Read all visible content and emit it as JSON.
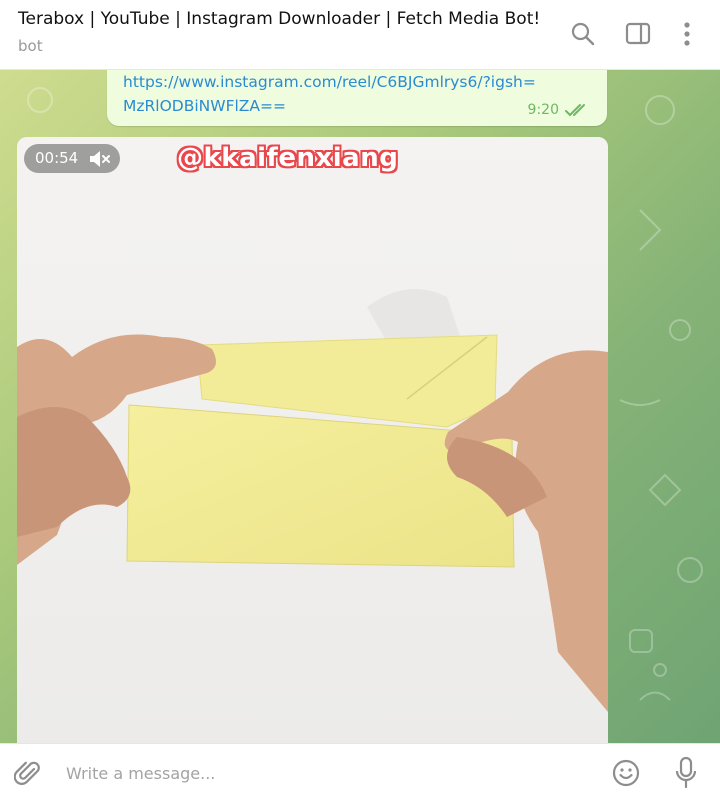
{
  "header": {
    "title": "Terabox | YouTube | Instagram Downloader | Fetch Media Bot!",
    "subtitle": "bot",
    "icons": [
      "search-icon",
      "sidebar-toggle-icon",
      "more-vertical-icon"
    ]
  },
  "message": {
    "link_text": "https://www.instagram.com/reel/C6BJGmlrys6/?igsh=MzRlODBiNWFlZA==",
    "time": "9:20",
    "status": "read"
  },
  "video": {
    "duration": "00:54",
    "muted": true,
    "watermark": "@kkaifenxiang"
  },
  "composer": {
    "placeholder": "Write a message...",
    "icons": [
      "paperclip-icon",
      "emoji-icon",
      "microphone-icon"
    ]
  },
  "colors": {
    "accent": "#2a8bd2",
    "bubble": "#effdde",
    "read_ticks": "#6db862"
  }
}
